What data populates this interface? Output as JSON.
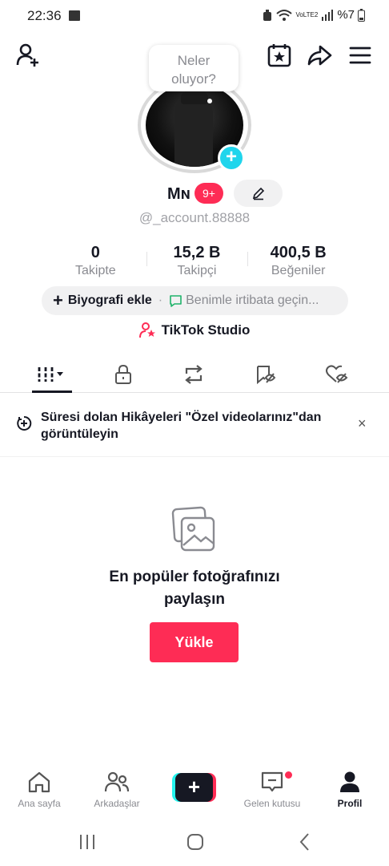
{
  "status_bar": {
    "time": "22:36",
    "battery": "%7",
    "network": "VoLTE2"
  },
  "bubble": {
    "text_line1": "Neler",
    "text_line2": "oluyor?"
  },
  "profile": {
    "name": "Mɴ",
    "badge": "9+",
    "username": "@_account.88888"
  },
  "stats": [
    {
      "value": "0",
      "label": "Takipte"
    },
    {
      "value": "15,2 B",
      "label": "Takipçi"
    },
    {
      "value": "400,5 B",
      "label": "Beğeniler"
    }
  ],
  "bio": {
    "add_label": "Biyografi ekle",
    "separator": "·",
    "contact_label": "Benimle irtibata geçin..."
  },
  "studio": {
    "label": "TikTok Studio"
  },
  "notice": {
    "text": "Süresi dolan Hikâyeleri \"Özel videolarınız\"dan görüntüleyin",
    "close": "×"
  },
  "empty_state": {
    "title_line1": "En popüler fotoğrafınızı",
    "title_line2": "paylaşın",
    "upload_label": "Yükle"
  },
  "bottom_nav": {
    "home": "Ana sayfa",
    "friends": "Arkadaşlar",
    "create": "+",
    "inbox": "Gelen kutusu",
    "profile": "Profil"
  },
  "colors": {
    "accent": "#fe2c55",
    "cyan": "#25f4ee",
    "text": "#161823",
    "muted": "#8a8b91"
  },
  "icons": {
    "top": [
      "add-user-icon",
      "calendar-star-icon",
      "share-icon",
      "menu-icon"
    ],
    "tabs": [
      "videos-grid-icon",
      "lock-icon",
      "repost-icon",
      "favorites-icon",
      "liked-icon"
    ]
  }
}
